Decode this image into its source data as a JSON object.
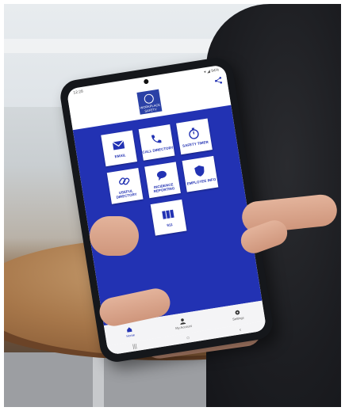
{
  "statusbar": {
    "time": "12:28",
    "right": "▾ ◢ 94%"
  },
  "logo": {
    "text": "WORKPLACE SAFETY"
  },
  "tiles": [
    {
      "label": "EMAIL",
      "icon": "mail-icon"
    },
    {
      "label": "CALL DIRECTORY",
      "icon": "phone-icon"
    },
    {
      "label": "SAFETY TIMER",
      "icon": "stopwatch-icon"
    },
    {
      "label": "USEFUL DIRECTORY",
      "icon": "link-icon"
    },
    {
      "label": "INCIDENCE REPORTING",
      "icon": "chat-icon"
    },
    {
      "label": "EMPLOYEE INFO",
      "icon": "shield-icon"
    },
    {
      "label": "911",
      "icon": "keypad-icon"
    }
  ],
  "bottomnav": [
    {
      "label": "Home",
      "icon": "home-icon"
    },
    {
      "label": "My Account",
      "icon": "user-icon"
    },
    {
      "label": "Settings",
      "icon": "gear-icon"
    }
  ],
  "colors": {
    "primary": "#2232b3",
    "logo_bg": "#2b41a6"
  }
}
